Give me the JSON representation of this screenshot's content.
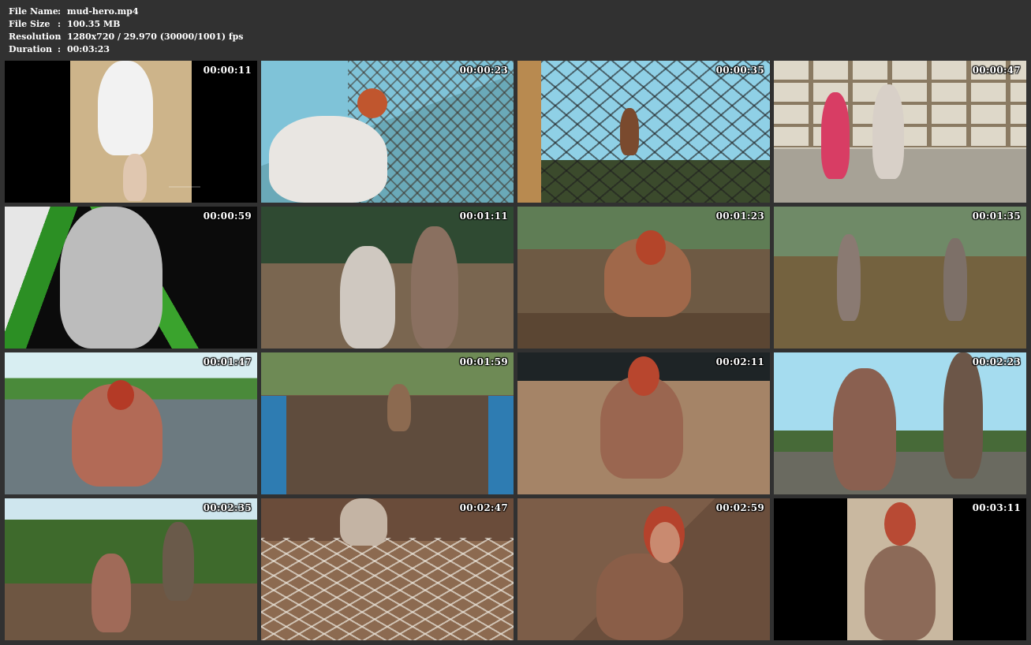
{
  "file_info": {
    "file_name_label": "File Name",
    "file_name": "mud-hero.mp4",
    "file_size_label": "File Size",
    "file_size": "100.35 MB",
    "resolution_label": "Resolution",
    "resolution": "1280x720 / 29.970 (30000/1001) fps",
    "duration_label": "Duration",
    "duration": "00:03:23",
    "separator": ":"
  },
  "thumbnails": [
    {
      "timestamp": "00:00:11"
    },
    {
      "timestamp": "00:00:23"
    },
    {
      "timestamp": "00:00:35"
    },
    {
      "timestamp": "00:00:47"
    },
    {
      "timestamp": "00:00:59"
    },
    {
      "timestamp": "00:01:11"
    },
    {
      "timestamp": "00:01:23"
    },
    {
      "timestamp": "00:01:35"
    },
    {
      "timestamp": "00:01:47"
    },
    {
      "timestamp": "00:01:59"
    },
    {
      "timestamp": "00:02:11"
    },
    {
      "timestamp": "00:02:23"
    },
    {
      "timestamp": "00:02:35"
    },
    {
      "timestamp": "00:02:47"
    },
    {
      "timestamp": "00:02:59"
    },
    {
      "timestamp": "00:03:11"
    }
  ],
  "colors": {
    "background": "#313131",
    "text": "#ffffff"
  }
}
